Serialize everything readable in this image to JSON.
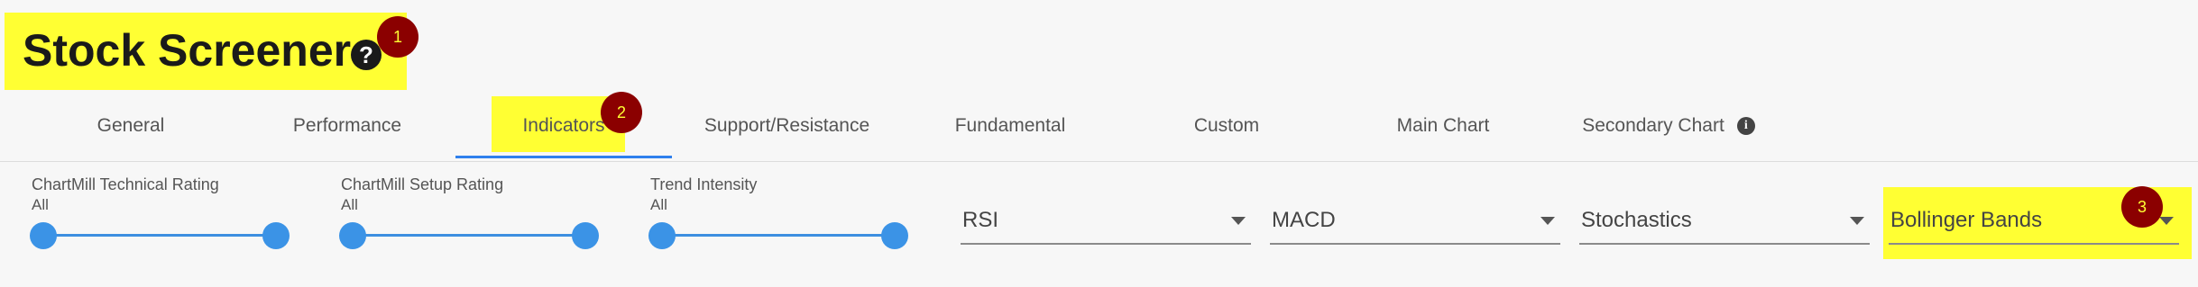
{
  "header": {
    "title": "Stock Screener",
    "help_icon_glyph": "?"
  },
  "tabs": [
    {
      "label": "General"
    },
    {
      "label": "Performance"
    },
    {
      "label": "Indicators",
      "active": true
    },
    {
      "label": "Support/Resistance"
    },
    {
      "label": "Fundamental"
    },
    {
      "label": "Custom"
    },
    {
      "label": "Main Chart"
    },
    {
      "label": "Secondary Chart",
      "info_icon_glyph": "i"
    }
  ],
  "range_filters": [
    {
      "label": "ChartMill Technical Rating",
      "value": "All"
    },
    {
      "label": "ChartMill Setup Rating",
      "value": "All"
    },
    {
      "label": "Trend Intensity",
      "value": "All"
    }
  ],
  "dropdowns": [
    {
      "value": "RSI"
    },
    {
      "value": "MACD"
    },
    {
      "value": "Stochastics"
    },
    {
      "value": "Bollinger Bands"
    }
  ],
  "markers": [
    "1",
    "2",
    "3"
  ],
  "colors": {
    "accent": "#2f80ed",
    "slider": "#3b93e6",
    "highlight": "#ffff33",
    "marker": "#8b0000"
  }
}
